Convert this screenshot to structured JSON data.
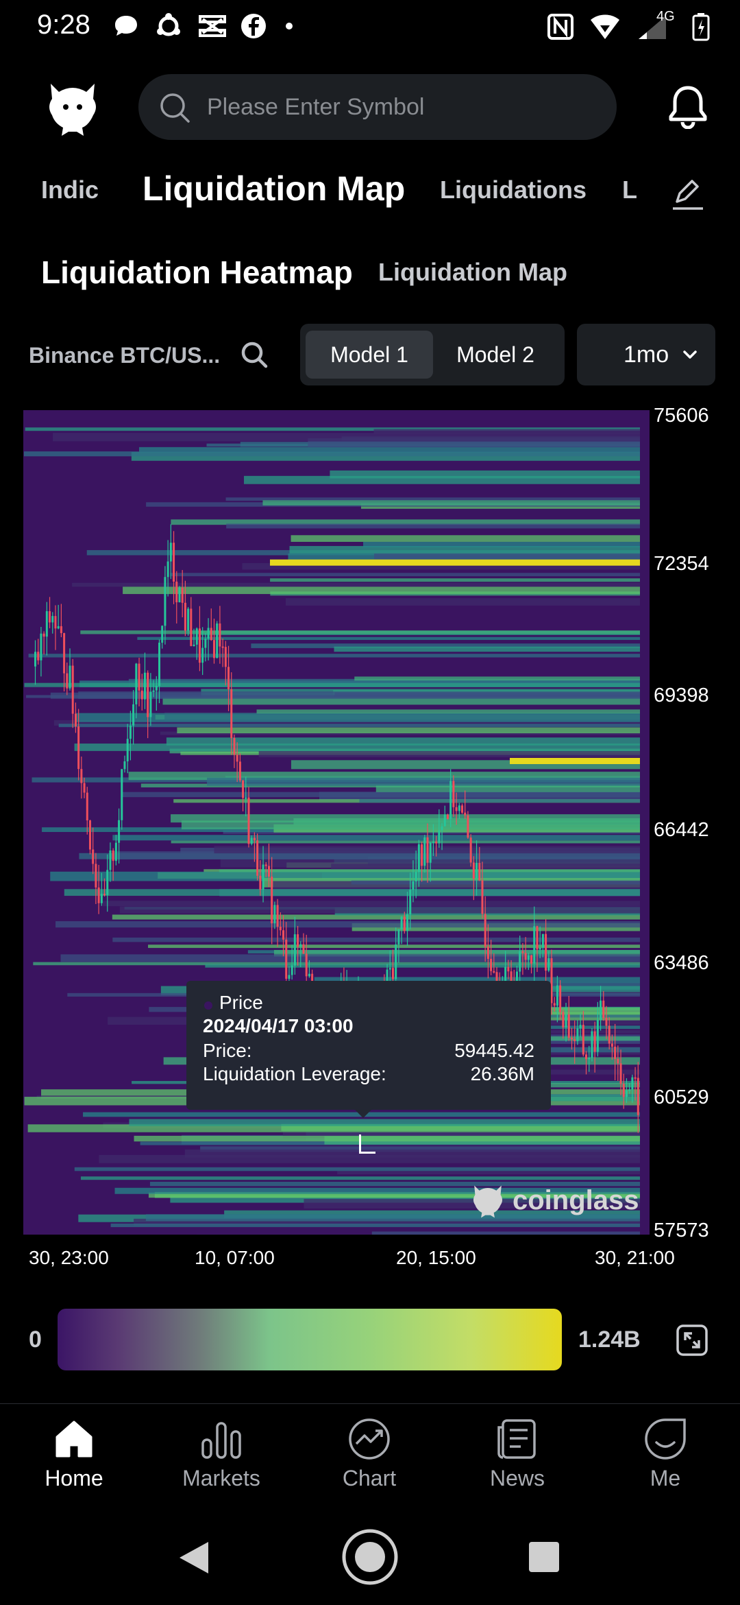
{
  "status_bar": {
    "time": "9:28",
    "network": "4G",
    "left_icons": [
      "chat-bubble-icon",
      "sync-icon",
      "capcut-icon",
      "facebook-icon",
      "dot-icon"
    ],
    "right_icons": [
      "nfc-icon",
      "wifi-icon",
      "signal-icon",
      "battery-charging-icon"
    ]
  },
  "header": {
    "search_placeholder": "Please Enter Symbol"
  },
  "top_tabs": [
    {
      "label": "Indic",
      "active": false
    },
    {
      "label": "Liquidation Map",
      "active": true
    },
    {
      "label": "Liquidations",
      "active": false
    },
    {
      "label": "L",
      "active": false
    }
  ],
  "sub_tabs": [
    {
      "label": "Liquidation Heatmap",
      "active": true
    },
    {
      "label": "Liquidation Map",
      "active": false
    }
  ],
  "controls": {
    "pair": "Binance BTC/US...",
    "models": [
      {
        "label": "Model 1",
        "active": true
      },
      {
        "label": "Model 2",
        "active": false
      }
    ],
    "period": "1mo"
  },
  "chart_data": {
    "type": "heatmap",
    "y_ticks": [
      "75606",
      "72354",
      "69398",
      "66442",
      "63486",
      "60529",
      "57573"
    ],
    "ylim": [
      57573,
      75606
    ],
    "x_ticks": [
      "30, 23:00",
      "10, 07:00",
      "20, 15:00",
      "30, 21:00"
    ],
    "price_path": [
      70000,
      71200,
      69800,
      67000,
      64500,
      66800,
      70000,
      69000,
      72500,
      71000,
      70200,
      70800,
      68000,
      66000,
      65000,
      63500,
      64000,
      61500,
      62500,
      63000,
      61800,
      63000,
      64500,
      65800,
      66500,
      67200,
      66000,
      64000,
      63000,
      63500,
      64200,
      62800,
      62000,
      61500,
      62500,
      61000,
      60500
    ],
    "bright_bands": [
      72280,
      67940
    ],
    "legend": {
      "min": "0",
      "max": "1.24B"
    },
    "watermark": "coinglass",
    "tooltip": {
      "series": "Price",
      "date": "2024/04/17 03:00",
      "rows": [
        {
          "label": "Price:",
          "value": "59445.42"
        },
        {
          "label": "Liquidation Leverage:",
          "value": "26.36M"
        }
      ]
    },
    "colors": {
      "background": "#3a1460",
      "low": "#3b1566",
      "mid": "#7cc48a",
      "high": "#e6d91f",
      "up_candle": "#26c69a",
      "down_candle": "#ef4f5c"
    }
  },
  "bottom_nav": [
    {
      "label": "Home",
      "icon": "home-icon",
      "active": true
    },
    {
      "label": "Markets",
      "icon": "markets-icon",
      "active": false
    },
    {
      "label": "Chart",
      "icon": "chart-icon",
      "active": false
    },
    {
      "label": "News",
      "icon": "news-icon",
      "active": false
    },
    {
      "label": "Me",
      "icon": "me-icon",
      "active": false
    }
  ]
}
